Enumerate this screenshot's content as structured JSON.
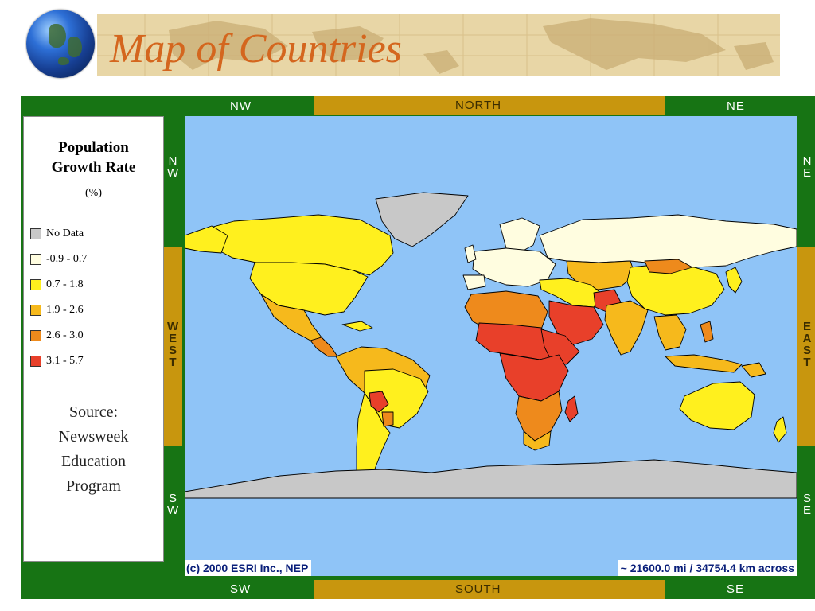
{
  "slide": {
    "title": "Map of Countries"
  },
  "frame": {
    "top_left": "NW",
    "top_center": "NORTH",
    "top_right": "NE",
    "bottom_left": "SW",
    "bottom_center": "SOUTH",
    "bottom_right": "SE",
    "left_upper": [
      "N",
      "W"
    ],
    "left_middle": [
      "W",
      "E",
      "S",
      "T"
    ],
    "left_lower": [
      "S",
      "W"
    ],
    "right_upper": [
      "N",
      "E"
    ],
    "right_middle": [
      "E",
      "A",
      "S",
      "T"
    ],
    "right_lower": [
      "S",
      "E"
    ]
  },
  "legend": {
    "title": "Population\nGrowth Rate",
    "unit": "(%)",
    "items": [
      {
        "label": "No Data",
        "color": "#c8c8c8"
      },
      {
        "label": "-0.9 - 0.7",
        "color": "#fffde0"
      },
      {
        "label": "0.7 - 1.8",
        "color": "#fff01e"
      },
      {
        "label": "1.9 - 2.6",
        "color": "#f6b91c"
      },
      {
        "label": "2.6 - 3.0",
        "color": "#ee8a1c"
      },
      {
        "label": "3.1 - 5.7",
        "color": "#e8402a"
      }
    ],
    "source": "Source:\nNewsweek\nEducation\nProgram"
  },
  "map": {
    "ocean_color": "#8fc4f7",
    "copyright": "(c) 2000 ESRI Inc., NEP",
    "scale": "~ 21600.0 mi / 34754.4 km across"
  },
  "colors": {
    "frame_green": "#177414",
    "frame_gold": "#c8960e",
    "title_orange": "#d4661e"
  }
}
